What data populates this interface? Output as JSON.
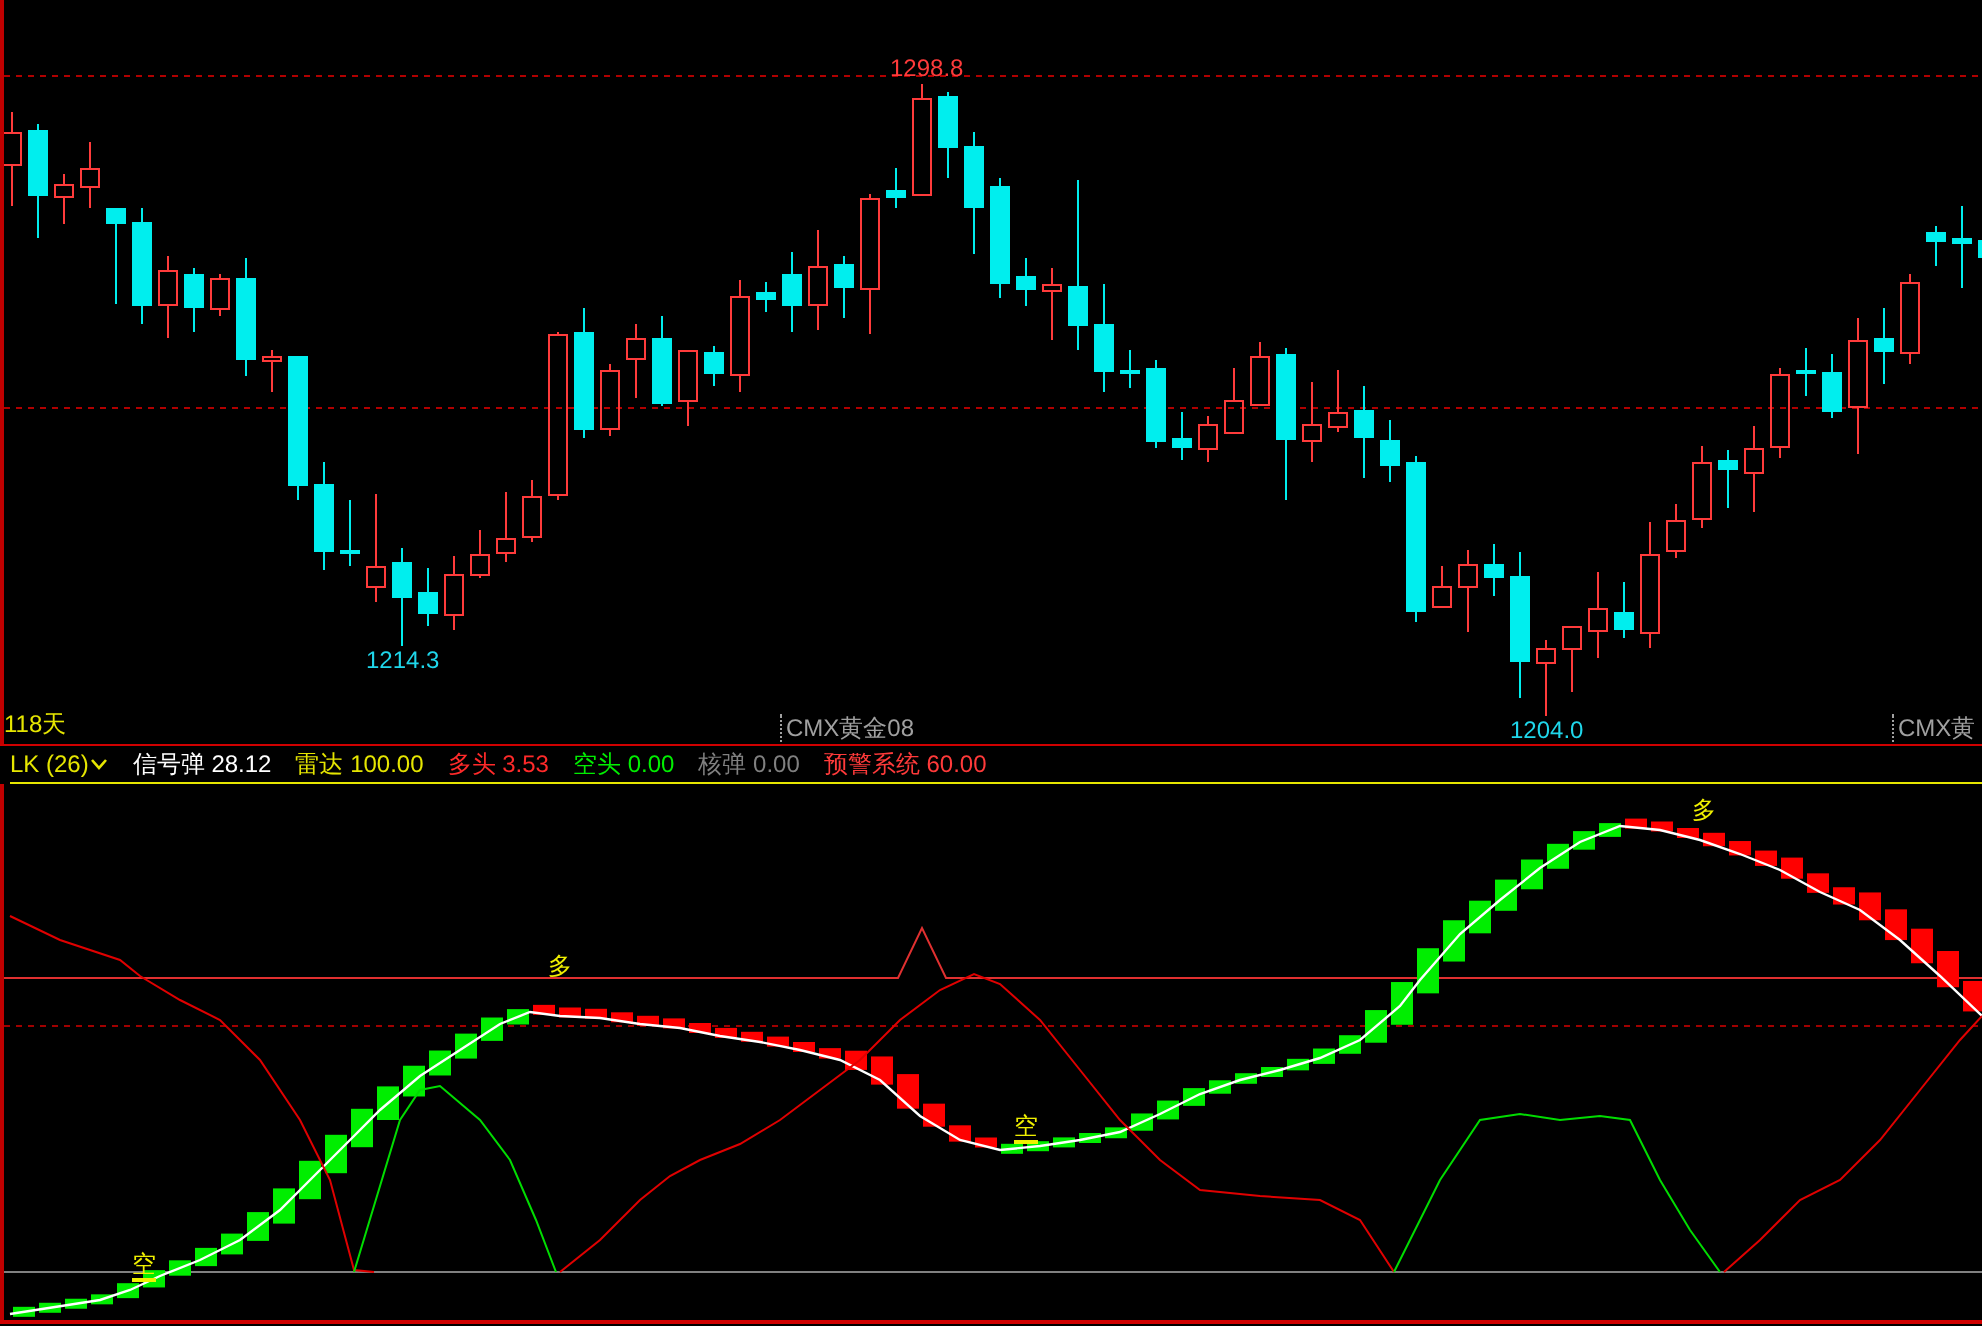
{
  "price_chart": {
    "price_labels": [
      {
        "text": "1298.8",
        "kind": "high"
      },
      {
        "text": "1214.3",
        "kind": "low"
      },
      {
        "text": "1204.0",
        "kind": "low"
      }
    ],
    "period_label": "118天",
    "symbol_labels": [
      "CMX黄金08",
      "CMX黄"
    ]
  },
  "indicator": {
    "name": "LK (26)",
    "items": [
      {
        "label": "信号弹",
        "value": "28.12",
        "kind": "signal"
      },
      {
        "label": "雷达",
        "value": "100.00",
        "kind": "radar"
      },
      {
        "label": "多头",
        "value": "3.53",
        "kind": "long"
      },
      {
        "label": "空头",
        "value": "0.00",
        "kind": "short"
      },
      {
        "label": "核弹",
        "value": "0.00",
        "kind": "nuke"
      },
      {
        "label": "预警系统",
        "value": "60.00",
        "kind": "warning"
      }
    ],
    "signals": [
      {
        "text": "空",
        "kind": "short"
      },
      {
        "text": "多",
        "kind": "long"
      },
      {
        "text": "空",
        "kind": "short"
      },
      {
        "text": "多",
        "kind": "long"
      }
    ]
  }
}
